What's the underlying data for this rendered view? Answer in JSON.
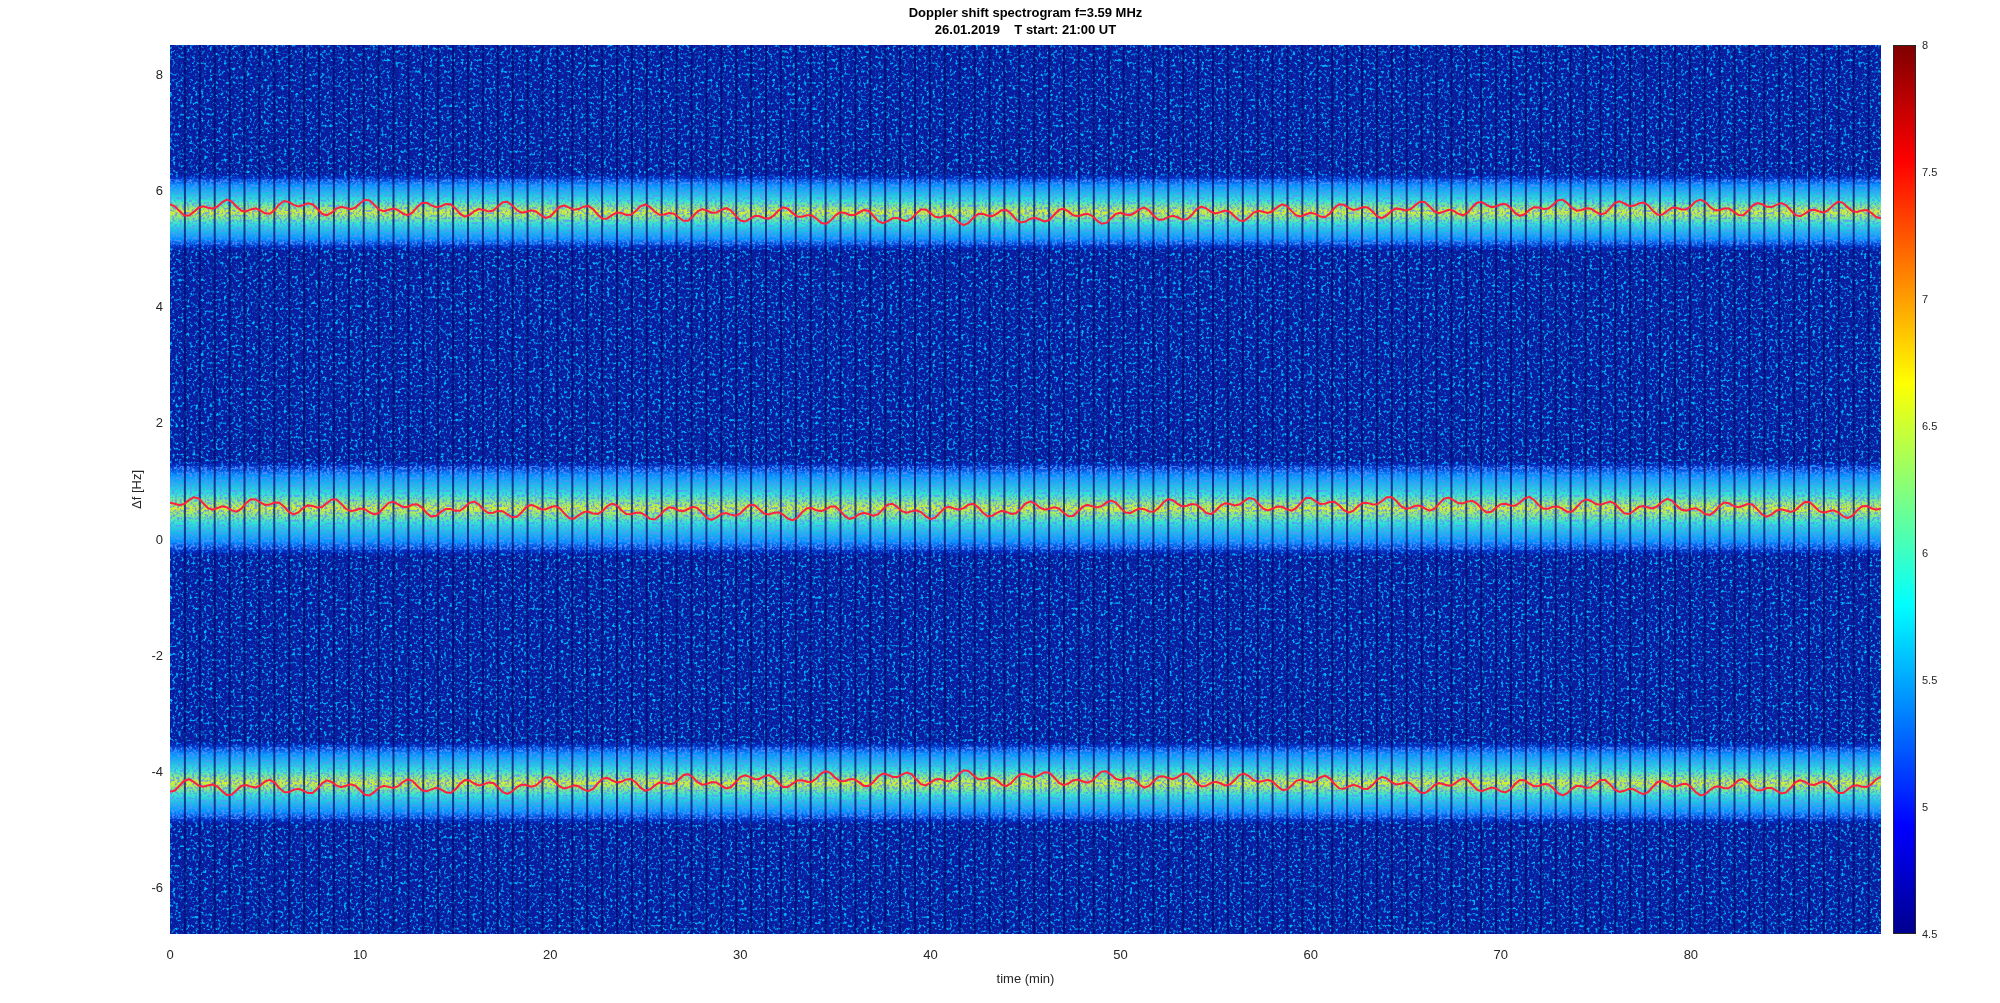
{
  "figure": {
    "title": "Doppler shift spectrogram f=3.59 MHz",
    "subtitle": "26.01.2019    T start: 21:00 UT",
    "y_axis": {
      "label": "Δf [Hz]",
      "ticks": [
        "8",
        "6",
        "4",
        "2",
        "0",
        "-2",
        "-4",
        "-6"
      ]
    },
    "x_axis": {
      "label": "time (min)",
      "ticks": [
        "0",
        "10",
        "20",
        "30",
        "40",
        "50",
        "60",
        "70",
        "80"
      ]
    },
    "colorbar": {
      "ticks": [
        "8",
        "7.5",
        "7",
        "6.5",
        "6",
        "5.5",
        "5",
        "4.5"
      ]
    }
  }
}
